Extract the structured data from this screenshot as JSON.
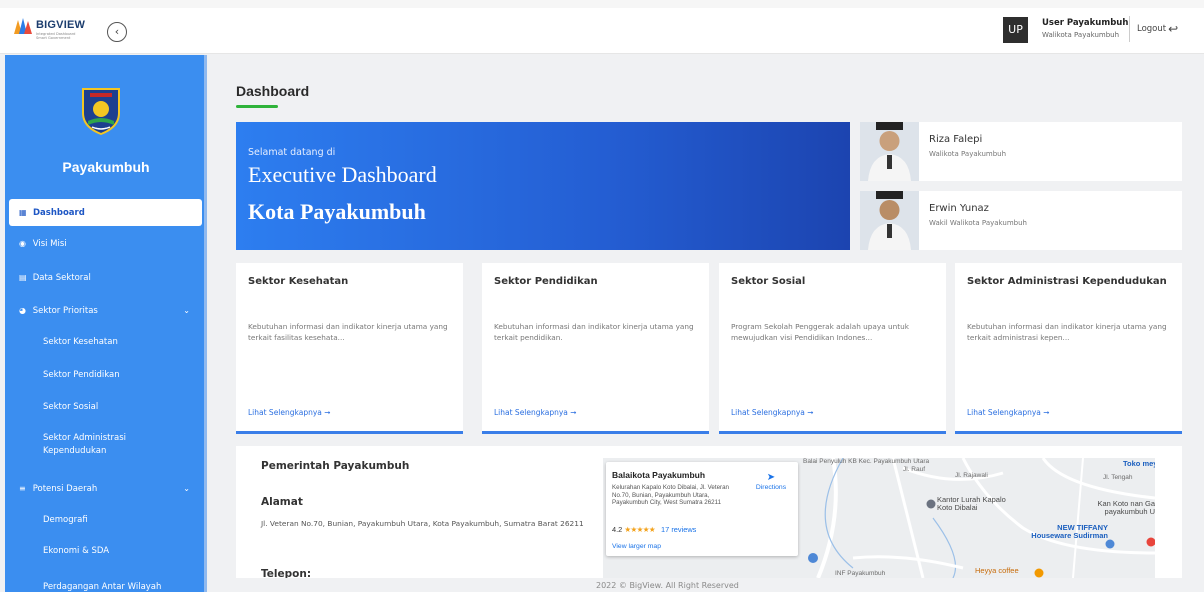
{
  "brand": {
    "name": "BIGVIEW",
    "tagline": "Integrated Dashboard Smart Government"
  },
  "user": {
    "initials": "UP",
    "name": "User Payakumbuh",
    "role": "Walikota Payakumbuh"
  },
  "header": {
    "logout_label": "Logout"
  },
  "sidebar": {
    "city": "Payakumbuh",
    "items": [
      {
        "label": "Dashboard",
        "icon": "grid-icon",
        "active": true
      },
      {
        "label": "Visi Misi",
        "icon": "target-icon"
      },
      {
        "label": "Data Sektoral",
        "icon": "table-icon"
      },
      {
        "label": "Sektor Prioritas",
        "icon": "pie-chart-icon",
        "expanded": true
      },
      {
        "label": "Potensi Daerah",
        "icon": "layers-icon",
        "expanded": true
      }
    ],
    "prioritas_subitems": [
      {
        "label": "Sektor Kesehatan"
      },
      {
        "label": "Sektor Pendidikan"
      },
      {
        "label": "Sektor Sosial"
      },
      {
        "label": "Sektor Administrasi Kependudukan"
      }
    ],
    "potensi_subitems": [
      {
        "label": "Demografi"
      },
      {
        "label": "Ekonomi & SDA"
      },
      {
        "label": "Perdagangan Antar Wilayah"
      }
    ]
  },
  "page": {
    "title": "Dashboard"
  },
  "hero": {
    "greeting": "Selamat datang di",
    "title": "Executive Dashboard",
    "city": "Kota Payakumbuh",
    "colors": {
      "start": "#2d7ef0",
      "end": "#1c44b0"
    }
  },
  "officials": [
    {
      "name": "Riza Falepi",
      "role": "Walikota Payakumbuh"
    },
    {
      "name": "Erwin Yunaz",
      "role": "Wakil Walikota Payakumbuh"
    }
  ],
  "cards": [
    {
      "title": "Sektor Kesehatan",
      "desc": "Kebutuhan informasi dan indikator kinerja utama yang terkait fasilitas kesehata...",
      "link": "Lihat Selengkapnya ➞"
    },
    {
      "title": "Sektor Pendidikan",
      "desc": "Kebutuhan informasi dan indikator kinerja utama yang terkait pendidikan.",
      "link": "Lihat Selengkapnya ➞"
    },
    {
      "title": "Sektor Sosial",
      "desc": "Program Sekolah Penggerak adalah upaya untuk mewujudkan visi Pendidikan Indones...",
      "link": "Lihat Selengkapnya ➞"
    },
    {
      "title": "Sektor Administrasi Kependudukan",
      "desc": "Kebutuhan informasi dan indikator kinerja utama yang terkait administrasi kepen...",
      "link": "Lihat Selengkapnya ➞"
    }
  ],
  "info": {
    "org": "Pemerintah Payakumbuh",
    "address_heading": "Alamat",
    "address": "Jl. Veteran No.70, Bunian, Payakumbuh Utara, Kota Payakumbuh, Sumatra Barat 26211",
    "phone_heading": "Telepon:"
  },
  "map": {
    "place": "Balaikota Payakumbuh",
    "address": "Kelurahan Kapalo Koto Dibalai, Jl. Veteran No.70, Bunian, Payakumbuh Utara, Payakumbuh City, West Sumatra 26211",
    "directions": "Directions",
    "rating": "4.2",
    "stars": "★★★★★",
    "reviews": "17 reviews",
    "larger": "View larger map",
    "labels": {
      "top_center": "Balai Penyuluh KB Kec. Payakumbuh Utara",
      "toko": "Toko meys",
      "kantor": "Kantor Lurah Kapalo Koto Dibalai",
      "kan_koto": "Kan Koto nan Ga payakumbuh U",
      "tiffany": "NEW TIFFANY Houseware Sudirman",
      "heyya": "Heyya coffee",
      "jl_rajawali": "Jl. Rajawali",
      "jl_rauf": "Jl. Rauf",
      "jl_tengah": "Jl. Tengah",
      "inf": "INF Payakumbuh"
    }
  },
  "footer": {
    "text": "2022 © BigView. All Right Reserved"
  }
}
